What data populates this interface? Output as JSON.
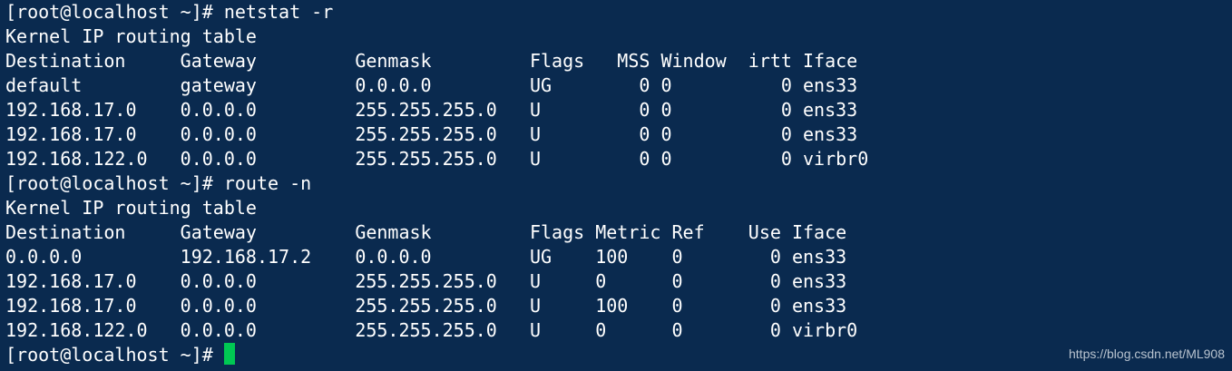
{
  "terminal": {
    "lines": [
      "[root@localhost ~]# netstat -r",
      "Kernel IP routing table",
      "Destination     Gateway         Genmask         Flags   MSS Window  irtt Iface",
      "default         gateway         0.0.0.0         UG        0 0          0 ens33",
      "192.168.17.0    0.0.0.0         255.255.255.0   U         0 0          0 ens33",
      "192.168.17.0    0.0.0.0         255.255.255.0   U         0 0          0 ens33",
      "192.168.122.0   0.0.0.0         255.255.255.0   U         0 0          0 virbr0",
      "[root@localhost ~]# route -n",
      "Kernel IP routing table",
      "Destination     Gateway         Genmask         Flags Metric Ref    Use Iface",
      "0.0.0.0         192.168.17.2    0.0.0.0         UG    100    0        0 ens33",
      "192.168.17.0    0.0.0.0         255.255.255.0   U     0      0        0 ens33",
      "192.168.17.0    0.0.0.0         255.255.255.0   U     100    0        0 ens33",
      "192.168.122.0   0.0.0.0         255.255.255.0   U     0      0        0 virbr0"
    ],
    "prompt": "[root@localhost ~]#",
    "cursor_color": "#00c853",
    "background_color": "#0a2a4f"
  },
  "watermark": "https://blog.csdn.net/ML908"
}
